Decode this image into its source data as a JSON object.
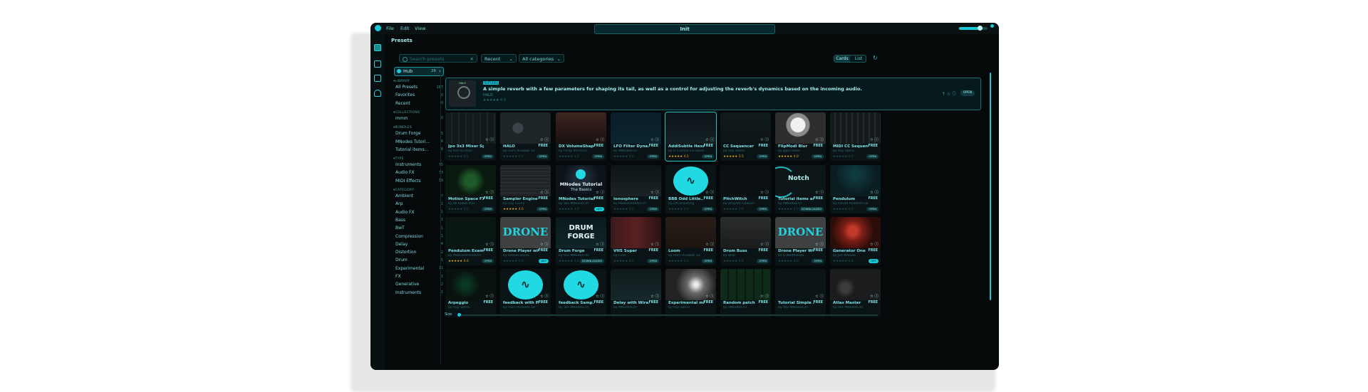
{
  "app": {
    "menu": [
      "File",
      "Edit",
      "View"
    ],
    "title": "Init"
  },
  "panel": {
    "title": "Presets"
  },
  "filters": {
    "search_placeholder": "Search presets",
    "sort": "Recent",
    "category": "All categories"
  },
  "view_toggle": {
    "cards": "Cards",
    "list": "List"
  },
  "sidebar": {
    "hub": {
      "label": "Hub",
      "count": "26"
    },
    "sections": [
      {
        "title": "LIBRARY",
        "items": [
          {
            "label": "All Presets",
            "count": "187"
          },
          {
            "label": "Favorites",
            "count": "0"
          },
          {
            "label": "Recent",
            "count": "0"
          }
        ]
      },
      {
        "title": "COLLECTIONS",
        "items": [
          {
            "label": "mmm",
            "count": "0"
          }
        ]
      },
      {
        "title": "BUNDLES",
        "items": [
          {
            "label": "Drum Forge",
            "count": "5"
          },
          {
            "label": "MNodes Tutori...",
            "count": "6"
          },
          {
            "label": "Tutorial items...",
            "count": "6"
          }
        ]
      },
      {
        "title": "TYPE",
        "items": [
          {
            "label": "Instruments",
            "count": "75"
          },
          {
            "label": "Audio FX",
            "count": "73"
          },
          {
            "label": "MIDI Effects",
            "count": "39"
          }
        ]
      },
      {
        "title": "CATEGORY",
        "items": [
          {
            "label": "Ambient",
            "count": "7"
          },
          {
            "label": "Arp",
            "count": "1"
          },
          {
            "label": "Audio FX",
            "count": "1"
          },
          {
            "label": "Bass",
            "count": "1"
          },
          {
            "label": "BwT",
            "count": "1"
          },
          {
            "label": "Compression",
            "count": "1"
          },
          {
            "label": "Delay",
            "count": "4"
          },
          {
            "label": "Distortion",
            "count": "2"
          },
          {
            "label": "Drum",
            "count": "5"
          },
          {
            "label": "Experimental",
            "count": "11"
          },
          {
            "label": "FX",
            "count": "1"
          },
          {
            "label": "Generative",
            "count": "2"
          },
          {
            "label": "Instruments",
            "count": "1"
          }
        ]
      }
    ]
  },
  "featured": {
    "badge": "FEATURED",
    "thumb_text": "HALO",
    "description": "A simple reverb with a few parameters for shaping its tail, as well as a control for adjusting the reverb's dynamics based on the incoming audio.",
    "name": "HALO",
    "stars": "★★★★★ 4.0",
    "open": "OPEN"
  },
  "cards": [
    {
      "name": "Jpo 3x3 Mixer Sp...",
      "free": "",
      "by": "by Karl Kristian",
      "stars": "★★★★★ 4.5",
      "btn": "OPEN",
      "gold": false
    },
    {
      "name": "HALO",
      "free": "FREE",
      "by": "by Harri Anawati 18",
      "stars": "★★★★★ 4.0",
      "btn": "OPEN",
      "gold": false
    },
    {
      "name": "DX VolumeShaper",
      "free": "FREE",
      "by": "by Philip Kendrick",
      "stars": "★★★★★ 4.0",
      "btn": "OPEN",
      "gold": false
    },
    {
      "name": "LFO Filter Dyna...",
      "free": "FREE",
      "by": "by MNodesCtrl",
      "stars": "★★★★★ 4.0",
      "btn": "OPEN",
      "gold": false
    },
    {
      "name": "AddiSubtle Hexa...",
      "free": "FREE",
      "by": "by P. Castilla Escudero",
      "stars": "★★★★★ 4.5",
      "btn": "OPEN",
      "gold": true
    },
    {
      "name": "CC Sequencer",
      "free": "FREE",
      "by": "by Ray Sbtroi",
      "stars": "★★★★★ 3.5",
      "btn": "OPEN",
      "gold": true
    },
    {
      "name": "FlipModl Blur",
      "free": "FREE",
      "by": "by Ippo Rebel",
      "stars": "★★★★★ 4.0",
      "btn": "OPEN",
      "gold": true
    },
    {
      "name": "MIDI CC Sequenc...",
      "free": "FREE",
      "by": "by Ray Sbtroi",
      "stars": "★★★★★ 4.0",
      "btn": "OPEN",
      "gold": false
    },
    {
      "name": "Motion Space FX",
      "free": "FREE",
      "by": "by Mr Robot Plus",
      "stars": "★★★★★ 4.0",
      "btn": "OPEN",
      "gold": false
    },
    {
      "name": "Sampler Engine",
      "free": "FREE",
      "by": "by Ray Lovell",
      "stars": "★★★★★ 4.0",
      "btn": "OPEN",
      "gold": true
    },
    {
      "name": "MNodes Tutorial...",
      "free": "FREE",
      "by": "by Vex MNodesCtrl",
      "stars": "★★★★★ 4.0",
      "btn": "GET",
      "gold": false
    },
    {
      "name": "Ionosphere",
      "free": "FREE",
      "by": "by MadcleArtedeCtrl",
      "stars": "★★★★★ 4.0",
      "btn": "OPEN",
      "gold": false
    },
    {
      "name": "BBB Odd Little...",
      "free": "FREE",
      "by": "by LPConsulting",
      "stars": "★★★★★ 4.0",
      "btn": "OPEN",
      "gold": false
    },
    {
      "name": "PitchWitch",
      "free": "FREE",
      "by": "by Brayden Lawson",
      "stars": "★★★★★ 4.0",
      "btn": "OPEN",
      "gold": false
    },
    {
      "name": "Tutorial items as...",
      "free": "FREE",
      "by": "by MNodesCtrl",
      "stars": "★★★★★ 4.0",
      "btn": "DOWNLOADED",
      "gold": false
    },
    {
      "name": "Pendulum",
      "free": "FREE",
      "by": "by Farrah AnadoMT18",
      "stars": "★★★★★ 4.0",
      "btn": "OPEN",
      "gold": false
    },
    {
      "name": "Pendulum Exam...",
      "free": "FREE",
      "by": "by MadcleArtedeCtrl",
      "stars": "★★★★★ 4.0",
      "btn": "OPEN",
      "gold": true
    },
    {
      "name": "Drone Player with...",
      "free": "FREE",
      "by": "by DroneCorp16",
      "stars": "★★★★★ 4.0",
      "btn": "GET",
      "gold": false
    },
    {
      "name": "Drum Forge",
      "free": "FREE",
      "by": "by Vex MNodesCtrl",
      "stars": "★★★★★ 4.0",
      "btn": "DOWNLOADED",
      "gold": false
    },
    {
      "name": "VHS Super",
      "free": "FREE",
      "by": "by Fuse",
      "stars": "★★★★★ 4.0",
      "btn": "OPEN",
      "gold": false
    },
    {
      "name": "Loom",
      "free": "FREE",
      "by": "by Harri Anawati 18",
      "stars": "★★★★★ 4.0",
      "btn": "OPEN",
      "gold": false
    },
    {
      "name": "Drum Buss",
      "free": "FREE",
      "by": "by Blob",
      "stars": "★★★★★ 4.0",
      "btn": "OPEN",
      "gold": false
    },
    {
      "name": "Drone Player Wi...",
      "free": "FREE",
      "by": "by D.NorthState",
      "stars": "★★★★★ 4.0",
      "btn": "OPEN",
      "gold": false
    },
    {
      "name": "Generator One",
      "free": "FREE",
      "by": "by Jon Manuel",
      "stars": "★★★★★ 4.0",
      "btn": "GET",
      "gold": false
    },
    {
      "name": "Arpeggio",
      "free": "FREE",
      "by": "by Ray Sbtroi",
      "stars": "",
      "btn": "",
      "gold": false
    },
    {
      "name": "feedback with P...",
      "free": "FREE",
      "by": "by Harri Anawati 18",
      "stars": "",
      "btn": "",
      "gold": false
    },
    {
      "name": "feedback Samp...",
      "free": "FREE",
      "by": "by Vex MNodesCtrl",
      "stars": "",
      "btn": "",
      "gold": false
    },
    {
      "name": "Delay with Wire...",
      "free": "FREE",
      "by": "by MNodesCtrl",
      "stars": "",
      "btn": "",
      "gold": false
    },
    {
      "name": "Experimental mi...",
      "free": "FREE",
      "by": "by Ray Sbtroi",
      "stars": "",
      "btn": "",
      "gold": false
    },
    {
      "name": "Random patch",
      "free": "FREE",
      "by": "by MNodesCtrl",
      "stars": "",
      "btn": "",
      "gold": false
    },
    {
      "name": "Tutorial Simple ...",
      "free": "FREE",
      "by": "by Vex MNodesCtrl",
      "stars": "",
      "btn": "",
      "gold": false
    },
    {
      "name": "Atlas Master",
      "free": "FREE",
      "by": "by Vex MNodesCtrl",
      "stars": "",
      "btn": "",
      "gold": false
    }
  ],
  "thumb_texts": {
    "mnodes_title": "MNodes Tutorial",
    "mnodes_sub": "The Basics",
    "notch": "Notch",
    "drone": "DRONE",
    "drum": "DRUM",
    "forge": "FORGE"
  },
  "size_label": "Size",
  "colors": {
    "accent": "#19c9d6",
    "background": "#05090a",
    "panel": "#0a1416"
  }
}
